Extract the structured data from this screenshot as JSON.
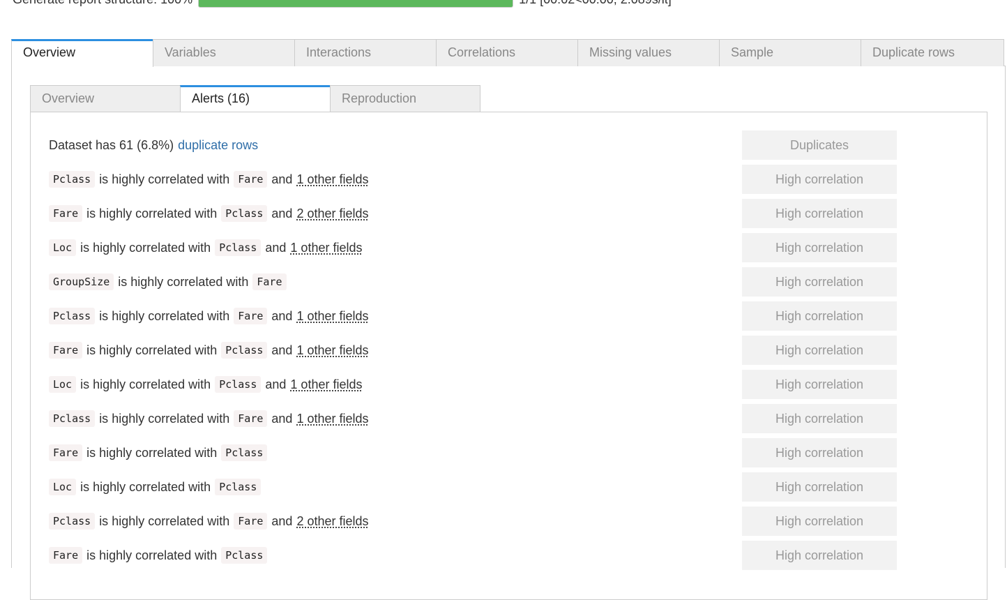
{
  "progress": {
    "label": "Generate report structure: 100%",
    "percent": 100,
    "suffix": "1/1 [00:02<00:00, 2.089s/it]",
    "bar_color": "#5cb85c"
  },
  "top_tabs": [
    {
      "label": "Overview",
      "active": true
    },
    {
      "label": "Variables"
    },
    {
      "label": "Interactions"
    },
    {
      "label": "Correlations"
    },
    {
      "label": "Missing values"
    },
    {
      "label": "Sample"
    },
    {
      "label": "Duplicate rows"
    }
  ],
  "sub_tabs": [
    {
      "label": "Overview"
    },
    {
      "label": "Alerts (16)",
      "active": true
    },
    {
      "label": "Reproduction"
    }
  ],
  "alerts": [
    {
      "type": "dup",
      "text": "Dataset has 61 (6.8%)",
      "link": "duplicate rows",
      "badge": "Duplicates"
    },
    {
      "type": "corr",
      "var": "Pclass",
      "mid": "is highly correlated with",
      "with": "Fare",
      "and": "and",
      "more": "1 other fields",
      "badge": "High correlation"
    },
    {
      "type": "corr",
      "var": "Fare",
      "mid": "is highly correlated with",
      "with": "Pclass",
      "and": "and",
      "more": "2 other fields",
      "badge": "High correlation"
    },
    {
      "type": "corr",
      "var": "Loc",
      "mid": "is highly correlated with",
      "with": "Pclass",
      "and": "and",
      "more": "1 other fields",
      "badge": "High correlation"
    },
    {
      "type": "corr",
      "var": "GroupSize",
      "mid": "is highly correlated with",
      "with": "Fare",
      "badge": "High correlation"
    },
    {
      "type": "corr",
      "var": "Pclass",
      "mid": "is highly correlated with",
      "with": "Fare",
      "and": "and",
      "more": "1 other fields",
      "badge": "High correlation"
    },
    {
      "type": "corr",
      "var": "Fare",
      "mid": "is highly correlated with",
      "with": "Pclass",
      "and": "and",
      "more": "1 other fields",
      "badge": "High correlation"
    },
    {
      "type": "corr",
      "var": "Loc",
      "mid": "is highly correlated with",
      "with": "Pclass",
      "and": "and",
      "more": "1 other fields",
      "badge": "High correlation"
    },
    {
      "type": "corr",
      "var": "Pclass",
      "mid": "is highly correlated with",
      "with": "Fare",
      "and": "and",
      "more": "1 other fields",
      "badge": "High correlation"
    },
    {
      "type": "corr",
      "var": "Fare",
      "mid": "is highly correlated with",
      "with": "Pclass",
      "badge": "High correlation"
    },
    {
      "type": "corr",
      "var": "Loc",
      "mid": "is highly correlated with",
      "with": "Pclass",
      "badge": "High correlation"
    },
    {
      "type": "corr",
      "var": "Pclass",
      "mid": "is highly correlated with",
      "with": "Fare",
      "and": "and",
      "more": "2 other fields",
      "badge": "High correlation"
    },
    {
      "type": "corr",
      "var": "Fare",
      "mid": "is highly correlated with",
      "with": "Pclass",
      "badge": "High correlation"
    }
  ]
}
